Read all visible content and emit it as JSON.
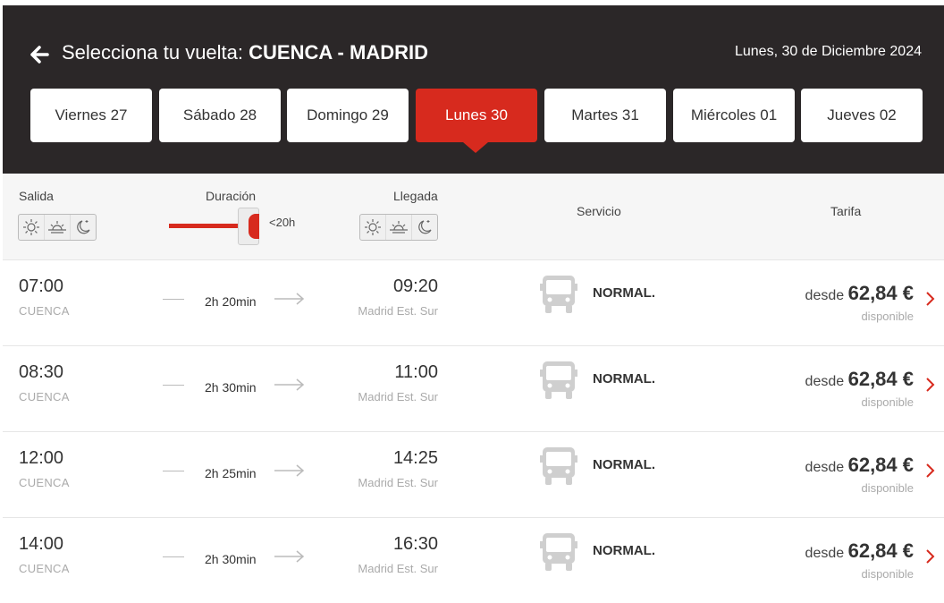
{
  "header": {
    "title_prefix": "Selecciona tu vuelta: ",
    "route": "CUENCA - MADRID",
    "date": "Lunes, 30 de Diciembre 2024"
  },
  "date_tabs": [
    {
      "label": "Viernes 27",
      "active": false
    },
    {
      "label": "Sábado 28",
      "active": false
    },
    {
      "label": "Domingo 29",
      "active": false
    },
    {
      "label": "Lunes 30",
      "active": true
    },
    {
      "label": "Martes 31",
      "active": false
    },
    {
      "label": "Miércoles 01",
      "active": false
    },
    {
      "label": "Jueves 02",
      "active": false
    }
  ],
  "filters": {
    "departure_label": "Salida",
    "duration_label": "Duración",
    "duration_value": "<20h",
    "arrival_label": "Llegada",
    "service_label": "Servicio",
    "fare_label": "Tarifa"
  },
  "trips": [
    {
      "dep_time": "07:00",
      "dep_city": "CUENCA",
      "duration": "2h 20min",
      "arr_time": "09:20",
      "arr_city": "Madrid Est. Sur",
      "service": "NORMAL.",
      "price_prefix": "desde",
      "price": "62,84 €",
      "availability": "disponible"
    },
    {
      "dep_time": "08:30",
      "dep_city": "CUENCA",
      "duration": "2h 30min",
      "arr_time": "11:00",
      "arr_city": "Madrid Est. Sur",
      "service": "NORMAL.",
      "price_prefix": "desde",
      "price": "62,84 €",
      "availability": "disponible"
    },
    {
      "dep_time": "12:00",
      "dep_city": "CUENCA",
      "duration": "2h 25min",
      "arr_time": "14:25",
      "arr_city": "Madrid Est. Sur",
      "service": "NORMAL.",
      "price_prefix": "desde",
      "price": "62,84 €",
      "availability": "disponible"
    },
    {
      "dep_time": "14:00",
      "dep_city": "CUENCA",
      "duration": "2h 30min",
      "arr_time": "16:30",
      "arr_city": "Madrid Est. Sur",
      "service": "NORMAL.",
      "price_prefix": "desde",
      "price": "62,84 €",
      "availability": "disponible"
    }
  ],
  "colors": {
    "header_bg": "#2b2728",
    "accent": "#d72a1e"
  },
  "icons": {
    "back": "arrow-left-icon",
    "morning": "sun-icon",
    "afternoon": "sunset-icon",
    "night": "moon-icon",
    "service": "bus-icon",
    "row_action": "chevron-right-icon"
  }
}
